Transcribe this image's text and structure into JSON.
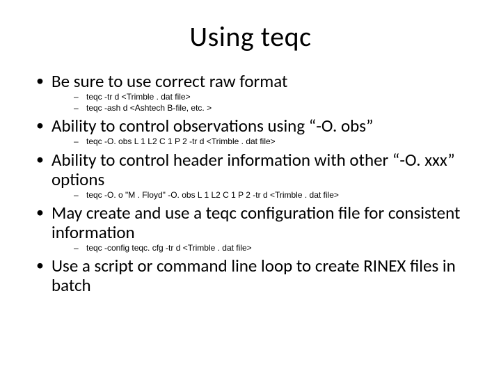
{
  "title": "Using teqc",
  "bullets": [
    {
      "text": "Be sure to use correct raw format",
      "sub": [
        "teqc -tr d <Trimble . dat file>",
        "teqc -ash d <Ashtech B-file, etc. >"
      ]
    },
    {
      "text": "Ability to control observations using “-O. obs”",
      "sub": [
        "teqc -O. obs L 1 L2 C 1 P 2 -tr d <Trimble . dat file>"
      ]
    },
    {
      "text": "Ability to control header information with other “-O. xxx” options",
      "sub": [
        "teqc -O. o \"M . Floyd\" -O. obs L 1 L2 C 1 P 2 -tr d <Trimble . dat file>"
      ]
    },
    {
      "text": "May create and use a teqc configuration file for consistent information",
      "sub": [
        "teqc -config teqc. cfg -tr d <Trimble . dat file>"
      ]
    },
    {
      "text": "Use a script or command line loop to create RINEX files in batch",
      "sub": []
    }
  ]
}
